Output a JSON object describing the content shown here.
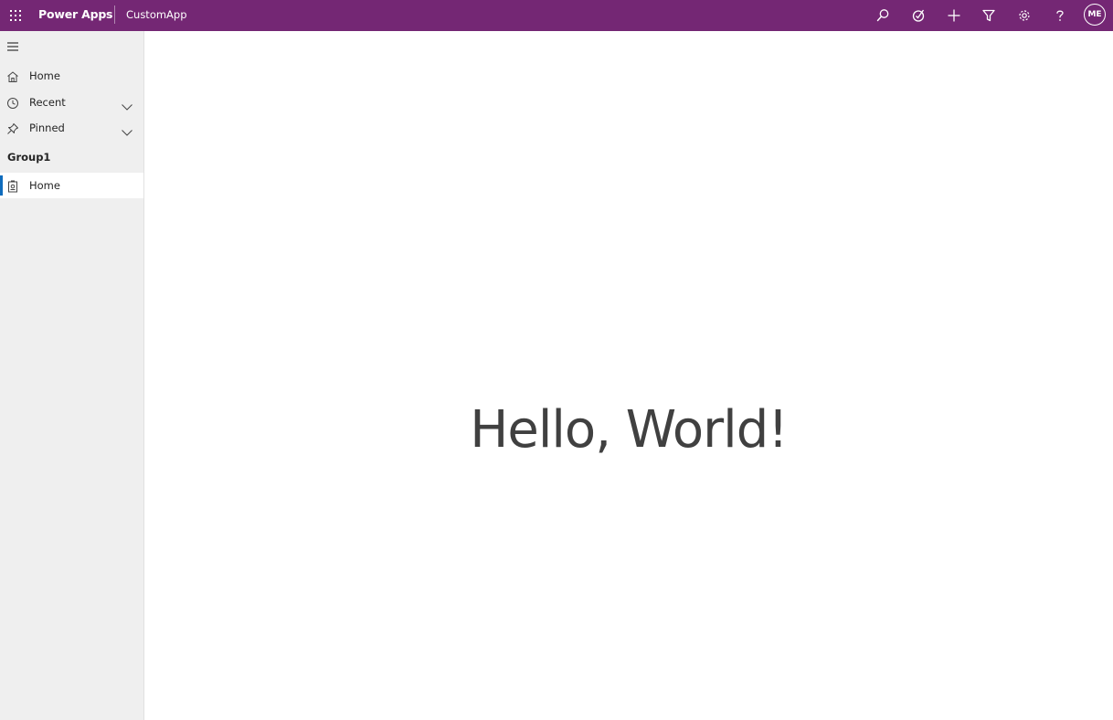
{
  "header": {
    "brand": "Power Apps",
    "app_name": "CustomApp",
    "avatar_initials": "ME",
    "icons": [
      "waffle-icon",
      "search-icon",
      "task-icon",
      "plus-icon",
      "filter-icon",
      "gear-icon",
      "help-icon"
    ],
    "colors": {
      "bar": "#742774",
      "text": "#ffffff"
    }
  },
  "sidebar": {
    "nav": [
      {
        "label": "Home",
        "icon": "home-icon"
      },
      {
        "label": "Recent",
        "icon": "clock-icon",
        "expandable": true
      },
      {
        "label": "Pinned",
        "icon": "pin-icon",
        "expandable": true
      }
    ],
    "group": {
      "label": "Group1",
      "items": [
        {
          "label": "Home",
          "icon": "page-icon",
          "selected": true
        }
      ]
    },
    "colors": {
      "background": "#efefef",
      "selected_background": "#ffffff",
      "selected_indicator": "#0f6cbd"
    }
  },
  "main": {
    "text": "Hello, World!"
  }
}
